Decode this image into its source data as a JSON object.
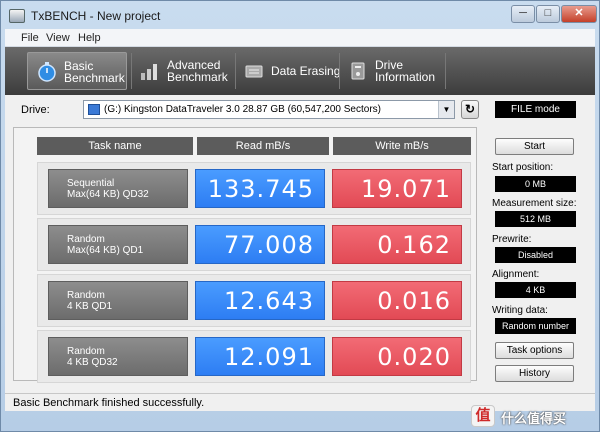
{
  "window": {
    "title": "TxBENCH - New project",
    "minimize": "─",
    "maximize": "□",
    "close": "✕"
  },
  "menu": [
    "File",
    "View",
    "Help"
  ],
  "toolbar": {
    "tools": [
      {
        "label": "Basic\nBenchmark",
        "icon": "stopwatch-icon"
      },
      {
        "label": "Advanced\nBenchmark",
        "icon": "bar-chart-icon"
      },
      {
        "label": "Data Erasing",
        "icon": "eraser-icon"
      },
      {
        "label": "Drive\nInformation",
        "icon": "drive-info-icon"
      }
    ]
  },
  "drive": {
    "label": "Drive:",
    "selected": "(G:) Kingston DataTraveler 3.0  28.87 GB (60,547,200 Sectors)",
    "mode": "FILE mode"
  },
  "table": {
    "headers": [
      "Task name",
      "Read mB/s",
      "Write mB/s"
    ],
    "rows": [
      {
        "task1": "Sequential",
        "task2": "Max(64 KB) QD32",
        "read": "133.745",
        "write": "19.071"
      },
      {
        "task1": "Random",
        "task2": "Max(64 KB) QD1",
        "read": "77.008",
        "write": "0.162"
      },
      {
        "task1": "Random",
        "task2": "4 KB QD1",
        "read": "12.643",
        "write": "0.016"
      },
      {
        "task1": "Random",
        "task2": "4 KB QD32",
        "read": "12.091",
        "write": "0.020"
      }
    ]
  },
  "side": {
    "start_button": "Start",
    "start_position_label": "Start position:",
    "start_position": "0 MB",
    "measurement_size_label": "Measurement size:",
    "measurement_size": "512 MB",
    "prewrite_label": "Prewrite:",
    "prewrite": "Disabled",
    "alignment_label": "Alignment:",
    "alignment": "4 KB",
    "writing_data_label": "Writing data:",
    "writing_data": "Random number",
    "task_options_button": "Task options",
    "history_button": "History"
  },
  "status": "Basic Benchmark finished successfully.",
  "watermark": {
    "badge": "值",
    "text": "什么值得买"
  },
  "colors": {
    "read": "#2d7df3",
    "write": "#e24a55",
    "toolbar": "#3c3c3c"
  }
}
